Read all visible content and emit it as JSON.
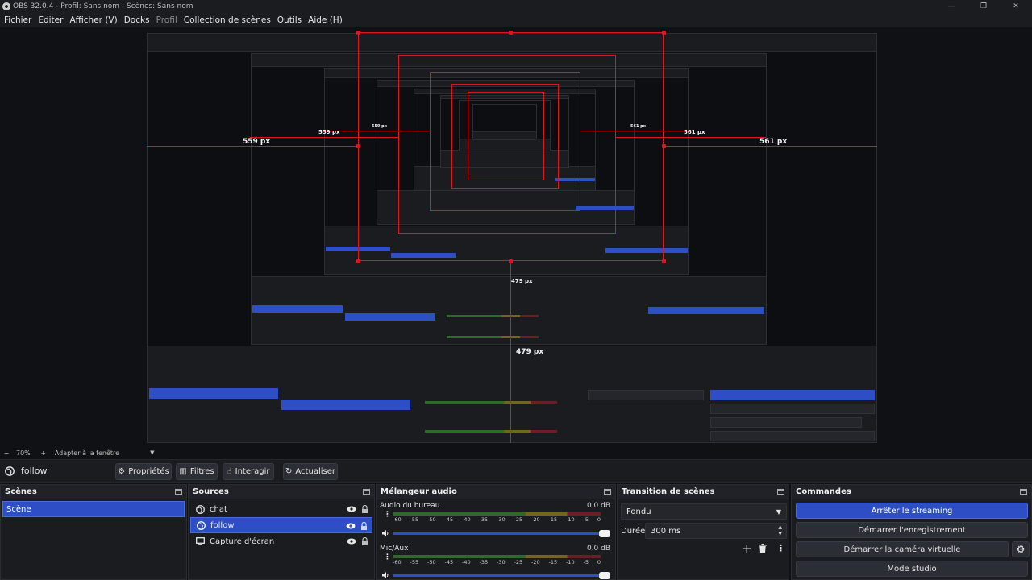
{
  "window": {
    "title": "OBS 32.0.4 - Profil: Sans nom - Scènes: Sans nom",
    "controls": [
      "—",
      "❐",
      "✕"
    ]
  },
  "menu": [
    {
      "label": "Fichier",
      "enabled": true
    },
    {
      "label": "Editer",
      "enabled": true
    },
    {
      "label": "Afficher (V)",
      "enabled": true
    },
    {
      "label": "Docks",
      "enabled": true
    },
    {
      "label": "Profil",
      "enabled": false
    },
    {
      "label": "Collection de scènes",
      "enabled": true
    },
    {
      "label": "Outils",
      "enabled": true
    },
    {
      "label": "Aide (H)",
      "enabled": true
    }
  ],
  "preview": {
    "labels": {
      "left_outer": "559 px",
      "right_outer": "561 px",
      "bottom_outer": "479 px",
      "left_inner": "559 px",
      "right_inner": "561 px",
      "bottom_inner": "479 px",
      "left_small": "559 px",
      "right_small": "561 px"
    }
  },
  "zoom": {
    "minus": "−",
    "value": "70%",
    "plus": "+",
    "fit": "Adapter à la fenêtre"
  },
  "source_toolbar": {
    "current_source": "follow",
    "properties": "Propriétés",
    "filters": "Filtres",
    "interact": "Interagir",
    "refresh": "Actualiser"
  },
  "docks": {
    "scenes": {
      "title": "Scènes",
      "items": [
        "Scène"
      ],
      "selected": 0
    },
    "sources": {
      "title": "Sources",
      "items": [
        {
          "name": "chat",
          "icon": "browser-icon",
          "selected": false
        },
        {
          "name": "follow",
          "icon": "browser-icon",
          "selected": true
        },
        {
          "name": "Capture d'écran",
          "icon": "monitor-icon",
          "selected": false
        }
      ]
    },
    "mixer": {
      "title": "Mélangeur audio",
      "ticks": [
        "-60",
        "-55",
        "-50",
        "-45",
        "-40",
        "-35",
        "-30",
        "-25",
        "-20",
        "-15",
        "-10",
        "-5",
        "0"
      ],
      "channels": [
        {
          "name": "Audio du bureau",
          "db": "0.0 dB",
          "level": 0.0
        },
        {
          "name": "Mic/Aux",
          "db": "0.0 dB",
          "level": 0.0
        }
      ]
    },
    "transitions": {
      "title": "Transition de scènes",
      "transition": "Fondu",
      "duration_label": "Durée",
      "duration": "300 ms"
    },
    "controls": {
      "title": "Commandes",
      "buttons": [
        {
          "label": "Arrêter le streaming",
          "active": true
        },
        {
          "label": "Démarrer l'enregistrement",
          "active": false
        },
        {
          "label": "Démarrer la caméra virtuelle",
          "active": false
        },
        {
          "label": "Mode studio",
          "active": false
        }
      ]
    }
  },
  "colors": {
    "accent": "#2d4ec4",
    "guide": "#e0141e",
    "background": "#101114",
    "panel": "#1b1c20"
  }
}
